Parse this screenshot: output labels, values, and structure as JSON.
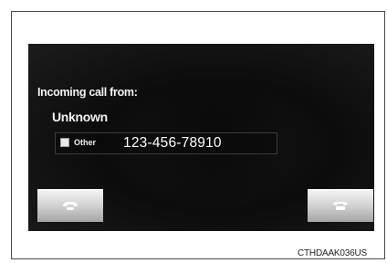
{
  "screen": {
    "incoming_label": "Incoming call from:",
    "caller_name": "Unknown",
    "number_type": "Other",
    "phone_number": "123-456-78910",
    "selected": false
  },
  "buttons": {
    "answer_icon": "phone-handset-icon",
    "decline_icon": "phone-handset-hangup-icon",
    "button_color": "#d2d2d2"
  },
  "caption": {
    "code": "CTHDAAK036US"
  }
}
